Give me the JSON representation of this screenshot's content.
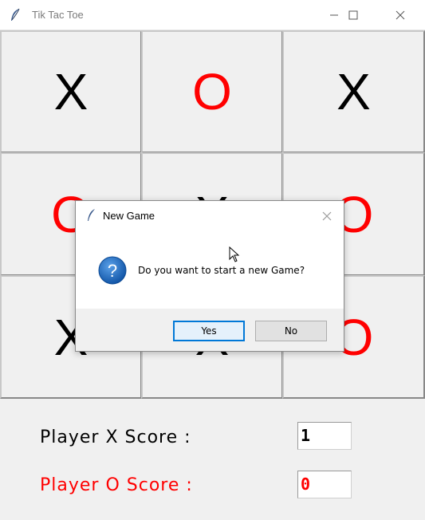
{
  "window": {
    "title": "Tik Tac Toe",
    "app_icon": "feather-icon",
    "controls": [
      "minimize-icon",
      "maximize-icon",
      "close-icon"
    ]
  },
  "board": {
    "cells": [
      {
        "mark": "X",
        "color": "#000000"
      },
      {
        "mark": "O",
        "color": "#ff0000"
      },
      {
        "mark": "X",
        "color": "#000000"
      },
      {
        "mark": "O",
        "color": "#ff0000"
      },
      {
        "mark": "X",
        "color": "#000000"
      },
      {
        "mark": "O",
        "color": "#ff0000"
      },
      {
        "mark": "X",
        "color": "#000000"
      },
      {
        "mark": "X",
        "color": "#000000"
      },
      {
        "mark": "O",
        "color": "#ff0000"
      }
    ]
  },
  "scores": {
    "player_x_label": "Player X Score :",
    "player_x_value": "1",
    "player_o_label": "Player O Score :",
    "player_o_value": "0"
  },
  "dialog": {
    "title": "New Game",
    "icon": "question-icon",
    "message": "Do you want to start a new Game?",
    "yes_label": "Yes",
    "no_label": "No"
  },
  "colors": {
    "x_color": "#000000",
    "o_color": "#ff0000",
    "accent": "#0078d7"
  }
}
